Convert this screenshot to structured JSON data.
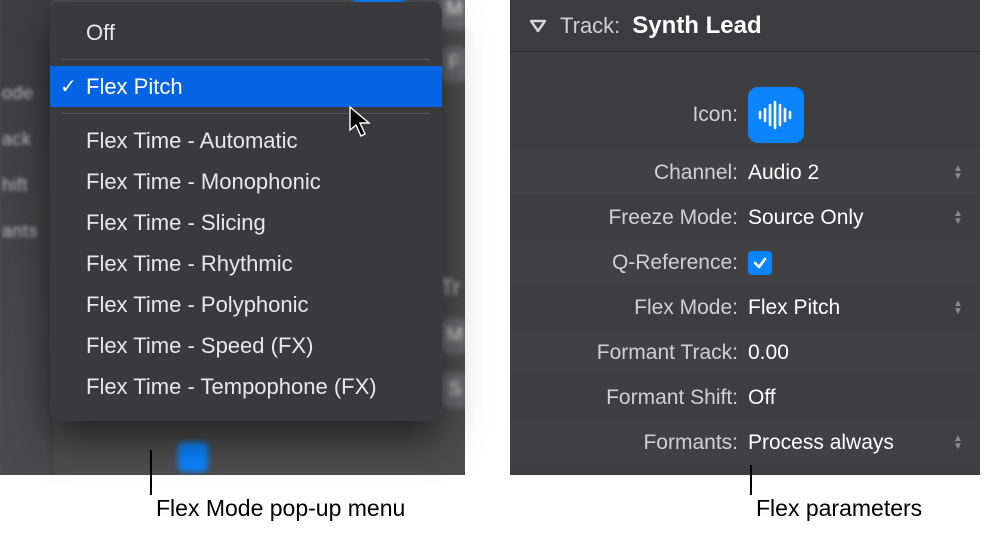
{
  "popup": {
    "items": [
      {
        "label": "Off"
      },
      {
        "label": "Flex Pitch",
        "selected": true
      },
      {
        "label": "Flex Time - Automatic"
      },
      {
        "label": "Flex Time - Monophonic"
      },
      {
        "label": "Flex Time - Slicing"
      },
      {
        "label": "Flex Time - Rhythmic"
      },
      {
        "label": "Flex Time - Polyphonic"
      },
      {
        "label": "Flex Time - Speed (FX)"
      },
      {
        "label": "Flex Time - Tempophone (FX)"
      }
    ]
  },
  "inspector": {
    "header_label": "Track:",
    "header_value": "Synth Lead",
    "icon_label": "Icon:",
    "rows": {
      "channel": {
        "label": "Channel:",
        "value": "Audio 2",
        "stepper": true
      },
      "freeze": {
        "label": "Freeze Mode:",
        "value": "Source Only",
        "stepper": true
      },
      "qref": {
        "label": "Q-Reference:",
        "checked": true
      },
      "flexmode": {
        "label": "Flex Mode:",
        "value": "Flex Pitch",
        "stepper": true
      },
      "ftrack": {
        "label": "Formant Track:",
        "value": "0.00"
      },
      "fshift": {
        "label": "Formant Shift:",
        "value": "Off"
      },
      "formants": {
        "label": "Formants:",
        "value": "Process always",
        "stepper": true
      }
    }
  },
  "bg_labels": {
    "ode1": "ode",
    "ode2": "ode",
    "ack": "ack",
    "hift": "hift",
    "ants": "ants",
    "tr": "Tr",
    "m": "M",
    "f": "F",
    "m2": "M",
    "s": "S"
  },
  "callouts": {
    "left": "Flex Mode pop-up menu",
    "right": "Flex parameters"
  }
}
